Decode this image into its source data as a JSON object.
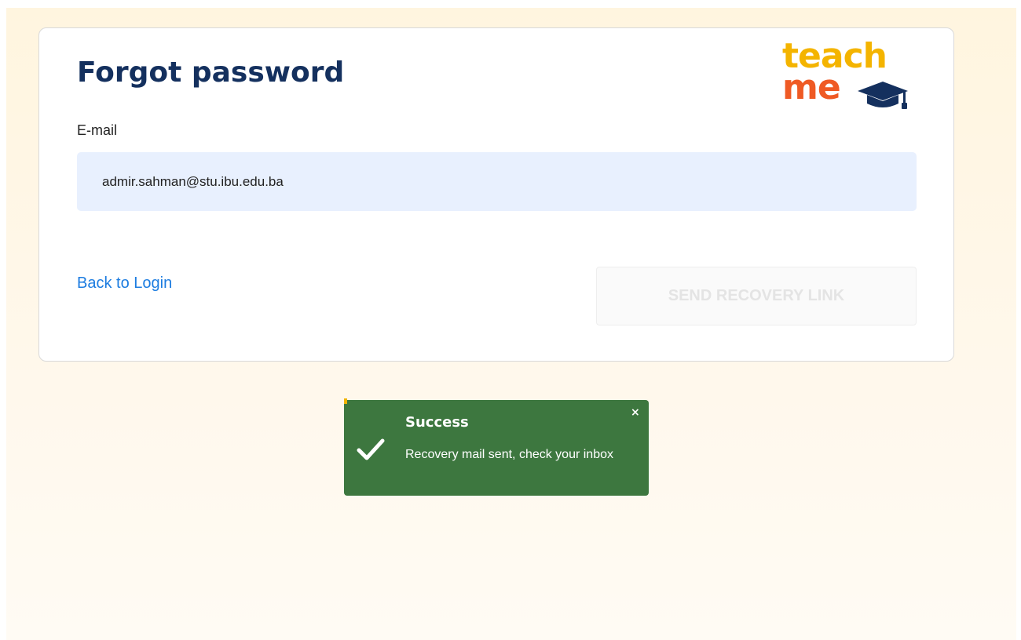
{
  "form": {
    "title": "Forgot password",
    "email_label": "E-mail",
    "email_value": "admir.sahman@stu.ibu.edu.ba",
    "back_link": "Back to Login",
    "submit_label": "SEND RECOVERY LINK"
  },
  "logo": {
    "line1": "teach",
    "line2": "me",
    "icon": "graduation-cap-icon",
    "colors": {
      "teach": "#f4b400",
      "me": "#ef5a24",
      "cap": "#14305e"
    }
  },
  "toast": {
    "title": "Success",
    "message": "Recovery mail sent, check your inbox",
    "close_label": "×",
    "icon": "check-icon",
    "color": "#3d773f"
  }
}
